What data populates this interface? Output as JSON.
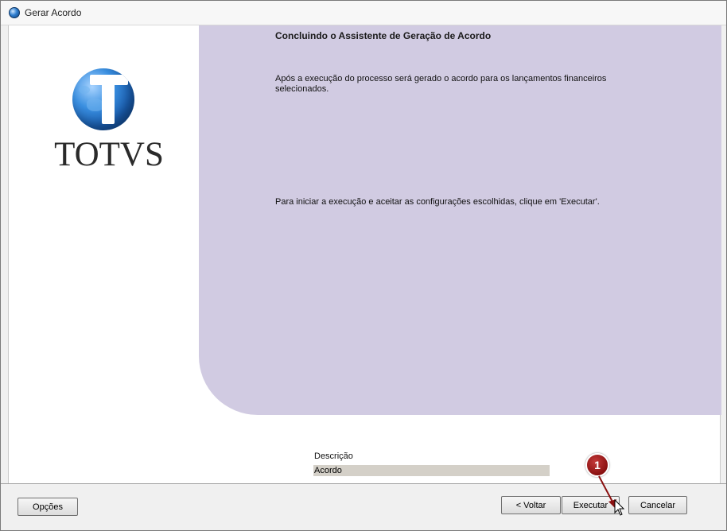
{
  "window": {
    "title": "Gerar Acordo"
  },
  "logo": {
    "brand": "TOTVS"
  },
  "wizard": {
    "heading": "Concluindo o Assistente de Geração de Acordo",
    "paragraph1": "Após a execução do processo será gerado o acordo para os lançamentos financeiros selecionados.",
    "paragraph2": "Para iniciar a execução e aceitar as configurações escolhidas, clique em 'Executar'."
  },
  "description": {
    "label": "Descrição",
    "value": "Acordo"
  },
  "buttons": {
    "options": "Opções",
    "back": "< Voltar",
    "execute": "Executar",
    "cancel": "Cancelar"
  },
  "annotation": {
    "step": "1",
    "color": "#8a1010"
  }
}
